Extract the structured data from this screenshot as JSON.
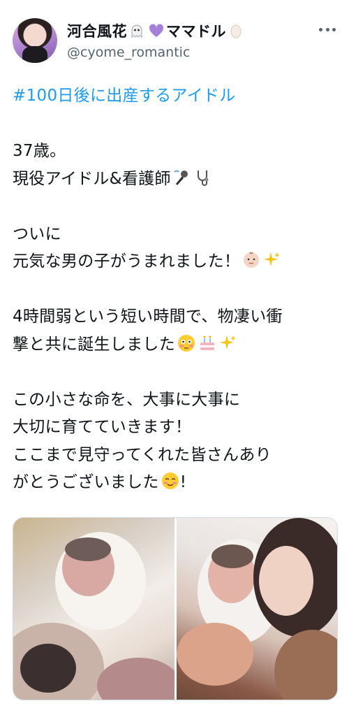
{
  "tweet": {
    "author": {
      "display_name": "河合風花",
      "name_suffix": "ママドル",
      "handle": "@cyome_romantic",
      "avatar_icon": "profile-photo",
      "name_emojis": [
        "ghost-emoji",
        "purple-heart-emoji",
        "egg-emoji"
      ]
    },
    "more_icon": "more-options-icon",
    "hashtag": "#100日後に出産するアイドル",
    "lines": {
      "l1": "37歳。",
      "l2": "現役アイドル&看護師",
      "l3": "ついに",
      "l4": "元気な男の子がうまれました！",
      "l5": "4時間弱という短い時間で、物凄い衝",
      "l6": "撃と共に誕生しました",
      "l7": "この小さな命を、大事に大事に",
      "l8": "大切に育てていきます！",
      "l9": "ここまで見守ってくれた皆さんあり",
      "l10": "がとうございました",
      "l10_end": "!"
    },
    "inline_emojis": {
      "l2": [
        "microphone-emoji",
        "stethoscope-emoji"
      ],
      "l4": [
        "baby-emoji",
        "sparkles-emoji"
      ],
      "l6": [
        "flushed-face-emoji",
        "birthday-cake-emoji",
        "sparkles-emoji"
      ],
      "l10": [
        "smiling-face-emoji"
      ]
    },
    "media": [
      "newborn-photo-1",
      "newborn-photo-2"
    ],
    "colors": {
      "link": "#1d9bf0",
      "text": "#0f1419",
      "secondary": "#536471"
    }
  }
}
